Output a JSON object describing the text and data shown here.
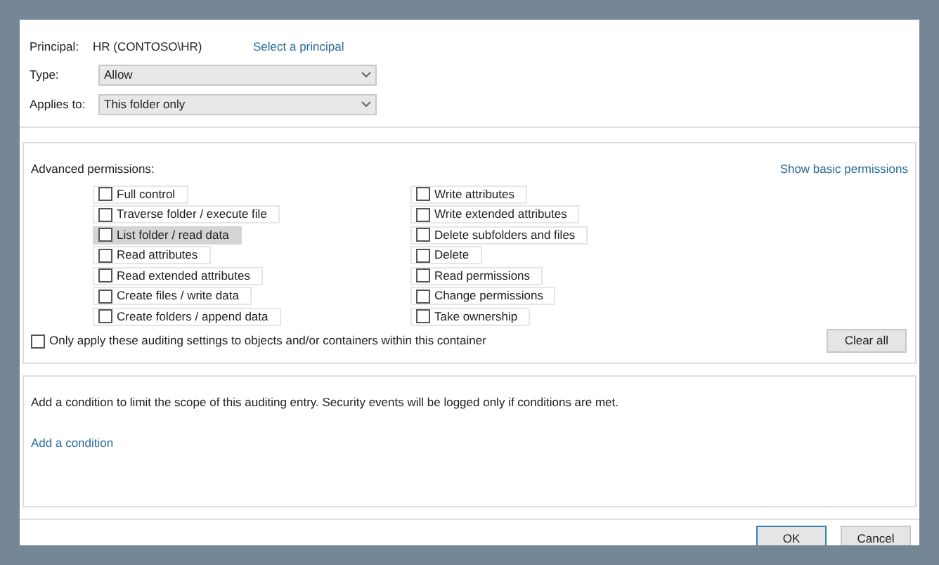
{
  "principal": {
    "label": "Principal:",
    "value": "HR (CONTOSO\\HR)",
    "link": "Select a principal"
  },
  "type": {
    "label": "Type:",
    "value": "Allow"
  },
  "applies_to": {
    "label": "Applies to:",
    "value": "This folder only"
  },
  "advanced": {
    "title": "Advanced permissions:",
    "link": "Show basic permissions",
    "left": [
      {
        "label": "Full control",
        "checked": false,
        "selected": false
      },
      {
        "label": "Traverse folder / execute file",
        "checked": false,
        "selected": false
      },
      {
        "label": "List folder / read data",
        "checked": false,
        "selected": true
      },
      {
        "label": "Read attributes",
        "checked": false,
        "selected": false
      },
      {
        "label": "Read extended attributes",
        "checked": false,
        "selected": false
      },
      {
        "label": "Create files / write data",
        "checked": false,
        "selected": false
      },
      {
        "label": "Create folders / append data",
        "checked": false,
        "selected": false
      }
    ],
    "right": [
      {
        "label": "Write attributes",
        "checked": false,
        "selected": false
      },
      {
        "label": "Write extended attributes",
        "checked": false,
        "selected": false
      },
      {
        "label": "Delete subfolders and files",
        "checked": false,
        "selected": false
      },
      {
        "label": "Delete",
        "checked": false,
        "selected": false
      },
      {
        "label": "Read permissions",
        "checked": false,
        "selected": false
      },
      {
        "label": "Change permissions",
        "checked": false,
        "selected": false
      },
      {
        "label": "Take ownership",
        "checked": false,
        "selected": false
      }
    ],
    "only_apply": {
      "label": "Only apply these auditing settings to objects and/or containers within this container",
      "checked": false
    },
    "clear_button": "Clear all"
  },
  "condition": {
    "text": "Add a condition to limit the scope of this auditing entry. Security events will be logged only if conditions are met.",
    "link": "Add a condition"
  },
  "buttons": [
    {
      "label": "OK",
      "selected": true
    },
    {
      "label": "Cancel",
      "selected": false
    }
  ]
}
